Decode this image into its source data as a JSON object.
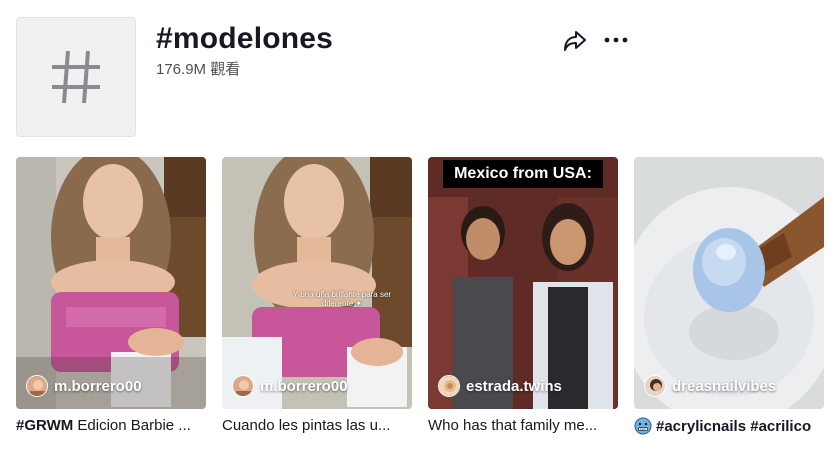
{
  "header": {
    "title": "#modelones",
    "views": "176.9M 觀看",
    "tag_icon": "hashtag-icon",
    "share_icon": "share-icon",
    "more_icon": "more-icon"
  },
  "videos": [
    {
      "author": "m.borrero00",
      "caption_tag": "#GRWM",
      "caption_text": " Edicion Barbie ..."
    },
    {
      "author": "m.borrero00",
      "overlay": "Y una uña brillante para ser diferente ✦",
      "caption_text": "Cuando les pintas las u..."
    },
    {
      "author": "estrada.twins",
      "banner": "Mexico from USA:",
      "caption_text": "Who has that family me..."
    },
    {
      "author": "dreasnailvibes",
      "caption_emoji": "cold-face-emoji",
      "caption_tag": "#acrylicnails #acrilico"
    }
  ]
}
